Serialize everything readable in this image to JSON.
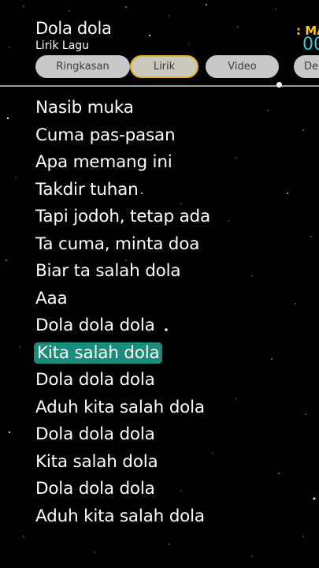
{
  "header": {
    "title": "Dola dola",
    "subtitle": "Lirik Lagu",
    "corner_label": ": MA",
    "corner_number": "00"
  },
  "tabs": [
    {
      "label": "Ringkasan",
      "active": false
    },
    {
      "label": "Lirik",
      "active": true
    },
    {
      "label": "Video",
      "active": false
    },
    {
      "label": "De",
      "active": false
    }
  ],
  "lyrics": {
    "current_index": 9,
    "lines": [
      "Nasib muka",
      "Cuma pas-pasan",
      "Apa memang ini",
      "Takdir tuhan",
      "Tapi jodoh, tetap ada",
      "Ta cuma, minta doa",
      "Biar ta salah dola",
      "Aaa",
      "Dola dola dola",
      "Kita salah dola",
      "Dola dola dola",
      "Aduh kita salah dola",
      "Dola dola dola",
      "Kita salah dola",
      "Dola dola dola",
      "Aduh kita salah dola"
    ]
  },
  "colors": {
    "highlight": "#1d8b7c",
    "active_tab_border": "#e8b318",
    "tab_background": "#c8c8c8",
    "accent_yellow": "#f5c518",
    "accent_cyan": "#35c7d8"
  }
}
